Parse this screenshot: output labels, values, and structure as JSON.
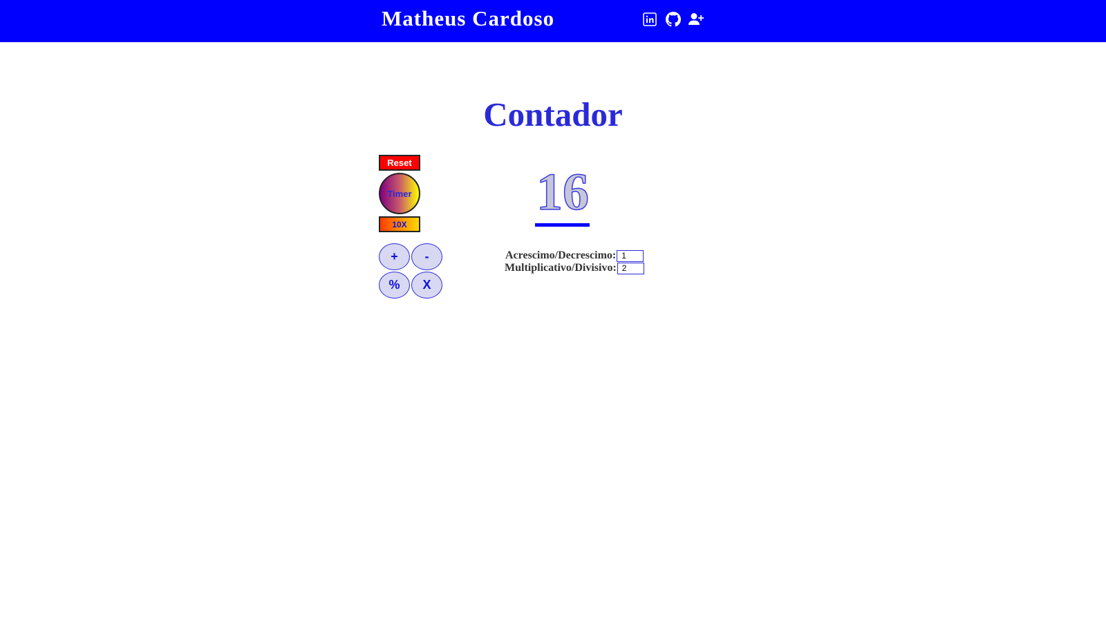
{
  "header": {
    "brand": "Matheus Cardoso",
    "links": [
      {
        "icon": "linkedin-icon"
      },
      {
        "icon": "github-icon"
      },
      {
        "icon": "add-user-icon"
      }
    ],
    "background_color": "#0000ff"
  },
  "page": {
    "title": "Contador"
  },
  "controls": {
    "reset_label": "Reset",
    "timer_label": "Timer",
    "tenx_label": "10X",
    "plus_label": "+",
    "minus_label": "-",
    "percent_label": "%",
    "times_label": "X"
  },
  "counter": {
    "value": "16"
  },
  "fields": {
    "increment_label": "Acrescimo/Decrescimo:",
    "increment_value": "1",
    "multiplier_label": "Multiplicativo/Divisivo:",
    "multiplier_value": "2"
  },
  "colors": {
    "accent": "#2a2ad9",
    "reset": "#ff0000",
    "operation_button": "#d8d8f2"
  }
}
